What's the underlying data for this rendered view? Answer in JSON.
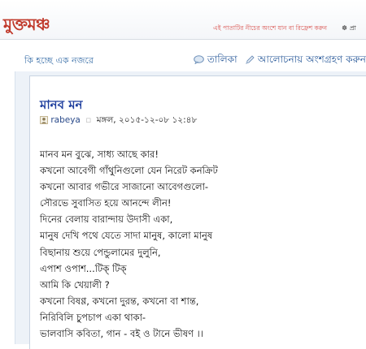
{
  "header": {
    "site_name": "মুক্তমঞ্চ",
    "refresh_note": "এই পাতাটির নীচের অংশে যান বা রিফ্রেশ করুন",
    "extra_link": "☸ প্রা"
  },
  "toolbar": {
    "whats_happening": "কি হচ্ছে এক নজরে",
    "list_link": "তালিকা",
    "discuss_link": "আলোচনায় অংশগ্রহণ করুন"
  },
  "post": {
    "title": "মানব মন",
    "author": "rabeya",
    "timestamp": "মঙ্গল, ২০১৫-১২-০৮ ১২:৪৮",
    "lines": [
      "মানব মন বুঝে, সাধ্য আছে কার!",
      "কখনো আবেগী গাঁথুনিগুলো যেন নিরেট কনক্রিট",
      "কখনো আবার গভীরে সাজানো আবেগগুলো-",
      "সৌরভে সুবাসিত হয়ে আনন্দে লীন!",
      "দিনের বেলায় বারান্দায় উদাসী একা,",
      "মানুষ দেখি পথে যেতে সাদা মানুষ, কালো মানুষ",
      "বিছানায় শুয়ে পেন্ডুলামের দুলুনি,",
      "এপাশ ওপাশ...টিক্ টিক্",
      "আমি কি খেয়ালী ?",
      "কখনো বিষণ্ণ, কখনো দুরন্ত, কখনো বা শান্ত,",
      "নিরিবিলি চুপচাপ একা থাকা-",
      "ভালবাসি কবিতা, গান - বই ও টানে ভীষণ ।।"
    ]
  },
  "colors": {
    "brand": "#c0392b",
    "link": "#2a5a9a",
    "title": "#1f3f9e",
    "panel_bg": "#edf2f8"
  }
}
